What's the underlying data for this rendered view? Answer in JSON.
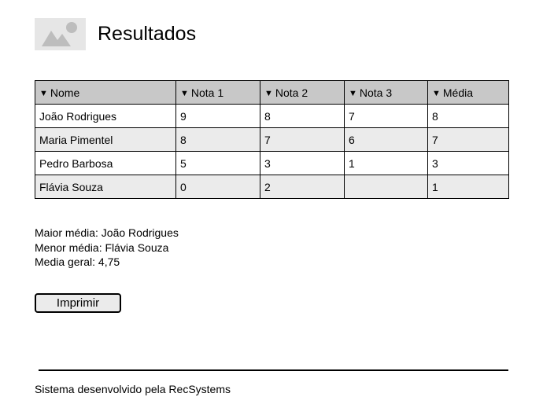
{
  "header": {
    "title": "Resultados",
    "logo_icon": "image-placeholder-icon"
  },
  "table": {
    "sort_icon": "sort-down-triangle-icon",
    "columns": [
      "Nome",
      "Nota 1",
      "Nota 2",
      "Nota 3",
      "Média"
    ],
    "rows": [
      [
        "João Rodrigues",
        "9",
        "8",
        "7",
        "8"
      ],
      [
        "Maria Pimentel",
        "8",
        "7",
        "6",
        "7"
      ],
      [
        "Pedro Barbosa",
        "5",
        "3",
        "1",
        "3"
      ],
      [
        "Flávia Souza",
        "0",
        "2",
        "",
        "1"
      ]
    ]
  },
  "summary": {
    "highest": "Maior média: João Rodrigues",
    "lowest": "Menor média: Flávia Souza",
    "overall": "Media geral: 4,75"
  },
  "actions": {
    "print_label": "Imprimir"
  },
  "footer": {
    "text": "Sistema desenvolvido pela RecSystems"
  },
  "colors": {
    "header_bg": "#c8c8c8",
    "zebra_bg": "#ebebeb",
    "placeholder_bg": "#e6e6e6",
    "placeholder_fg": "#bdbdbd"
  }
}
